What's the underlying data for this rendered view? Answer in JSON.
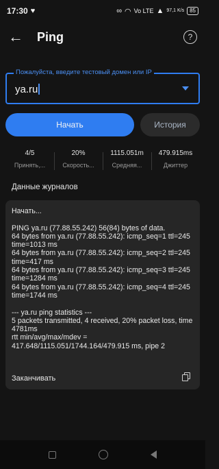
{
  "status_bar": {
    "time": "17:30",
    "network": "Vo LTE",
    "speed": "97,1 K/s",
    "battery": "85"
  },
  "app_bar": {
    "title": "Ping"
  },
  "input": {
    "label": "Пожалуйста, введите тестовый домен или IP",
    "value": "ya.ru"
  },
  "buttons": {
    "start": "Начать",
    "history": "История"
  },
  "stats": [
    {
      "value": "4/5",
      "label": "Принять,..."
    },
    {
      "value": "20%",
      "label": "Скорость..."
    },
    {
      "value": "1115.051m",
      "label": "Средняя..."
    },
    {
      "value": "479.915ms",
      "label": "Джиттер"
    }
  ],
  "log": {
    "section_title": "Данные журналов",
    "text": "Начать...\n\nPING ya.ru (77.88.55.242) 56(84) bytes of data.\n64 bytes from ya.ru (77.88.55.242): icmp_seq=1 ttl=245 time=1013 ms\n64 bytes from ya.ru (77.88.55.242): icmp_seq=2 ttl=245 time=417 ms\n64 bytes from ya.ru (77.88.55.242): icmp_seq=3 ttl=245 time=1284 ms\n64 bytes from ya.ru (77.88.55.242): icmp_seq=4 ttl=245 time=1744 ms\n\n--- ya.ru ping statistics ---\n5 packets transmitted, 4 received, 20% packet loss, time 4781ms\nrtt min/avg/max/mdev = 417.648/1115.051/1744.164/479.915 ms, pipe 2",
    "footer": "Заканчивать"
  },
  "colors": {
    "accent": "#2f7df1",
    "background": "#141414",
    "card": "#262626"
  }
}
